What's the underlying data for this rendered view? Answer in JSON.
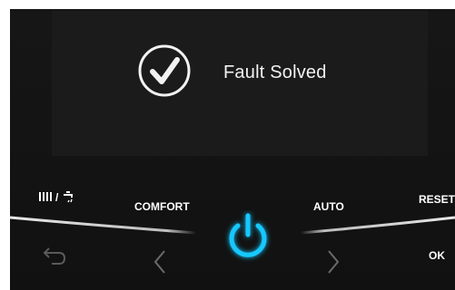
{
  "display": {
    "message": "Fault Solved",
    "status_icon": "checkmark-circle-icon"
  },
  "controls": {
    "heating_water_icon": "heating-and-hot-water-icon",
    "mode_separator": "/",
    "comfort_label": "COMFORT",
    "auto_label": "AUTO",
    "reset_label": "RESET",
    "ok_label": "OK",
    "back_icon": "back-arrow-icon",
    "left_icon": "chevron-left-icon",
    "right_icon": "chevron-right-icon",
    "power_icon": "power-icon"
  },
  "colors": {
    "power_glow": "#19c8ff",
    "panel": "#141414",
    "text": "#ffffff"
  }
}
